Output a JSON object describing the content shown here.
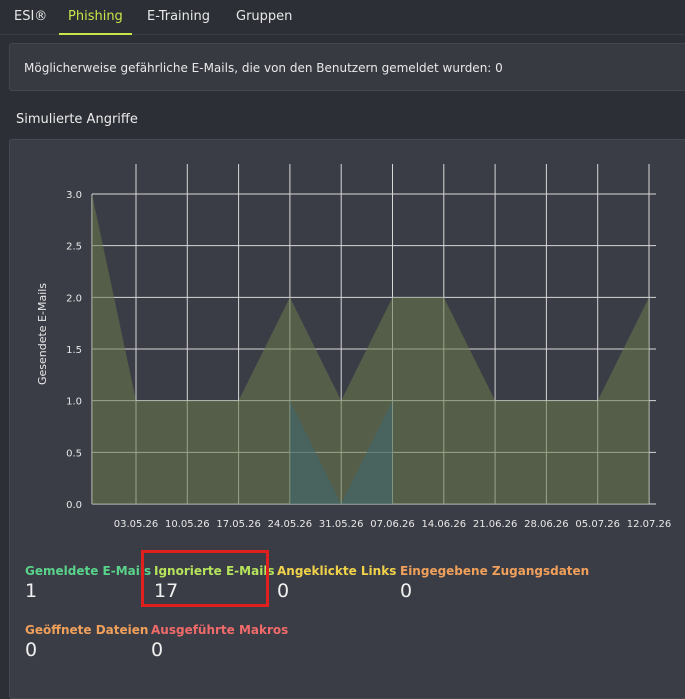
{
  "tabs": [
    {
      "label": "ESI®",
      "active": false
    },
    {
      "label": "Phishing",
      "active": true
    },
    {
      "label": "E-Training",
      "active": false
    },
    {
      "label": "Gruppen",
      "active": false
    }
  ],
  "banner": {
    "text": "Möglicherweise gefährliche E-Mails, die von den Benutzern gemeldet wurden: 0"
  },
  "section": {
    "title": "Simulierte Angriffe"
  },
  "chart_data": {
    "type": "area",
    "ylabel": "Gesendete E-Mails",
    "ylim": [
      0,
      3
    ],
    "y_ticks": [
      "0.0",
      "0.5",
      "1.0",
      "1.5",
      "2.0",
      "2.5",
      "3.0"
    ],
    "x_ticks": [
      "03.05.26",
      "10.05.26",
      "17.05.26",
      "24.05.26",
      "31.05.26",
      "07.06.26",
      "14.06.26",
      "21.06.26",
      "28.06.26",
      "05.07.26",
      "12.07.26"
    ],
    "grid": true,
    "series": [
      {
        "color": "#6a7a4a",
        "x": [
          "26.04.26",
          "03.05.26",
          "10.05.26",
          "17.05.26",
          "24.05.26",
          "31.05.26",
          "07.06.26",
          "14.06.26",
          "21.06.26",
          "28.06.26",
          "05.07.26",
          "12.07.26"
        ],
        "values": [
          3,
          1,
          1,
          1,
          2,
          1,
          2,
          2,
          1,
          1,
          1,
          2
        ]
      },
      {
        "color": "#3f6a72",
        "x": [
          "24.05.26",
          "31.05.26",
          "07.06.26"
        ],
        "values": [
          1,
          0,
          1
        ]
      }
    ]
  },
  "stats": [
    {
      "label": "Gemeldete E-Mails",
      "value": "1",
      "color": "#5ad38a"
    },
    {
      "label": "Ignorierte E-Mails",
      "value": "17",
      "color": "#b5e35c"
    },
    {
      "label": "Angeklickte Links",
      "value": "0",
      "color": "#f0d24a"
    },
    {
      "label": "Eingegebene Zugangsdaten",
      "value": "0",
      "color": "#f0a05a"
    },
    {
      "label": "Geöffnete Dateien",
      "value": "0",
      "color": "#f0a05a"
    },
    {
      "label": "Ausgeführte Makros",
      "value": "0",
      "color": "#f06a6a"
    }
  ]
}
